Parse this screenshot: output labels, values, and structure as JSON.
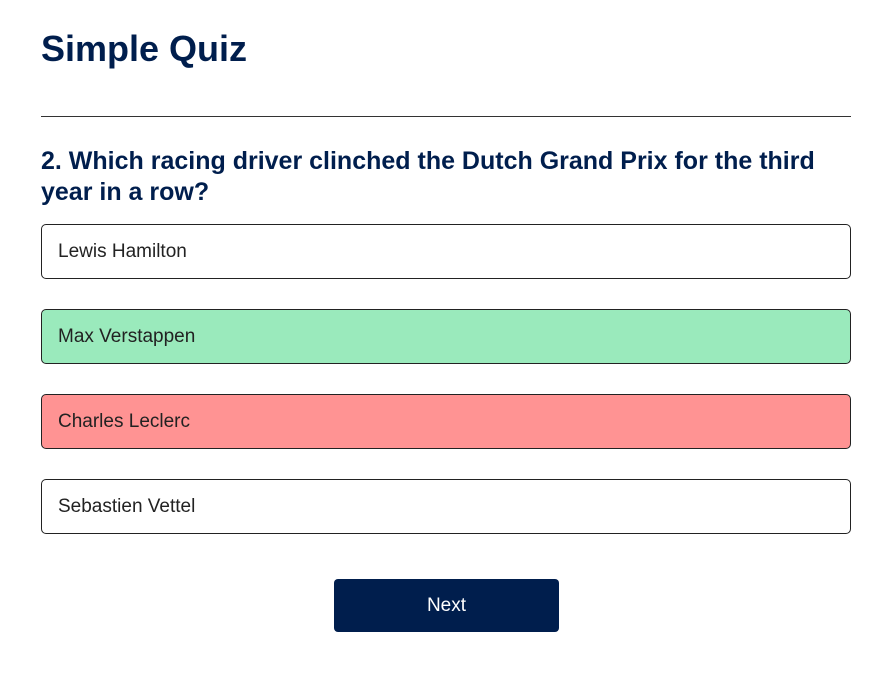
{
  "quiz": {
    "title": "Simple Quiz",
    "question": "2. Which racing driver clinched the Dutch Grand Prix for the third year in a row?",
    "answers": [
      {
        "label": "Lewis Hamilton",
        "state": "default"
      },
      {
        "label": "Max Verstappen",
        "state": "correct"
      },
      {
        "label": "Charles Leclerc",
        "state": "incorrect"
      },
      {
        "label": "Sebastien Vettel",
        "state": "default"
      }
    ],
    "next_label": "Next"
  },
  "colors": {
    "primary": "#001e4d",
    "correct": "#9aeabc",
    "incorrect": "#ff9393"
  }
}
